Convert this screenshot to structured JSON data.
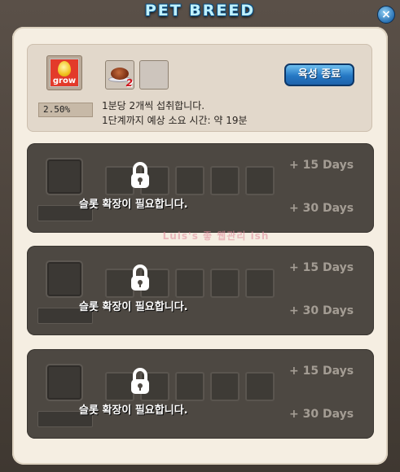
{
  "window": {
    "title": "PET BREED",
    "close_label": "×"
  },
  "top": {
    "grow_label": "grow",
    "percent": "2.50%",
    "food_count": "2",
    "info_line1": "1분당 2개씩 섭취합니다.",
    "info_line2": "1단계까지 예상 소요 시간: 약 19분",
    "end_button": "육성 종료"
  },
  "slots": [
    {
      "message": "슬롯 확장이 필요합니다.",
      "option1": "+ 15 Days",
      "option2": "+ 30 Days"
    },
    {
      "message": "슬롯 확장이 필요합니다.",
      "option1": "+ 15 Days",
      "option2": "+ 30 Days"
    },
    {
      "message": "슬롯 확장이 필요합니다.",
      "option1": "+ 15 Days",
      "option2": "+ 30 Days"
    }
  ],
  "watermark": "Luis's 좋 웹관리 ish",
  "colors": {
    "accent": "#2a78c4",
    "panel": "#f5eee2",
    "slot_bg": "#4d4842",
    "days_text": "#a49d94"
  }
}
